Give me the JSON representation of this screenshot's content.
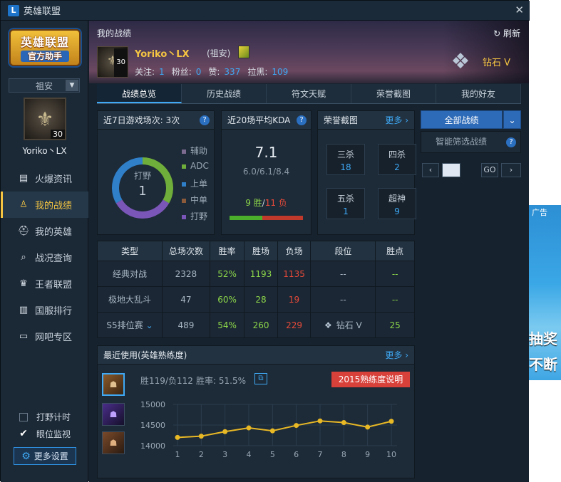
{
  "window": {
    "title": "英雄联盟"
  },
  "sidebar": {
    "logo_line1": "英雄联盟",
    "logo_line2": "官方助手",
    "server": "祖安",
    "level": "30",
    "username": "Yoriko丶LX",
    "nav": [
      {
        "label": "火爆资讯",
        "icon": "fire-icon",
        "glyph": "▤"
      },
      {
        "label": "我的战绩",
        "icon": "user-icon",
        "glyph": "♙",
        "active": true
      },
      {
        "label": "我的英雄",
        "icon": "helmet-icon",
        "glyph": "⛑"
      },
      {
        "label": "战况查询",
        "icon": "search-icon",
        "glyph": "⌕"
      },
      {
        "label": "王者联盟",
        "icon": "crown-icon",
        "glyph": "♛"
      },
      {
        "label": "国服排行",
        "icon": "chart-icon",
        "glyph": "▥"
      },
      {
        "label": "网吧专区",
        "icon": "monitor-icon",
        "glyph": "▭"
      }
    ],
    "jungle_timer": "打野计时",
    "ward_monitor": "眼位监视",
    "more_settings": "更多设置"
  },
  "header": {
    "breadcrumb": "我的战绩",
    "refresh": "刷新",
    "player_name": "Yoriko丶LX",
    "player_server": "(祖安)",
    "level": "30",
    "follow_label": "关注:",
    "follow": "1",
    "fans_label": "粉丝:",
    "fans": "0",
    "likes_label": "赞:",
    "likes": "337",
    "block_label": "拉黑:",
    "block": "109",
    "rank": "钻石 V"
  },
  "tabs": [
    "战绩总览",
    "历史战绩",
    "符文天赋",
    "荣誉截图",
    "我的好友"
  ],
  "recent7": {
    "title": "近7日游戏场次: 3次",
    "center_label": "打野",
    "center_value": "1",
    "legend": [
      {
        "label": "辅助",
        "color": "#7d6a8f"
      },
      {
        "label": "ADC",
        "color": "#6fae3a"
      },
      {
        "label": "上单",
        "color": "#2f7fc9"
      },
      {
        "label": "中单",
        "color": "#8a5a3a"
      },
      {
        "label": "打野",
        "color": "#7a56b8"
      }
    ],
    "donut": [
      {
        "value": 1,
        "color": "#6fae3a"
      },
      {
        "value": 1,
        "color": "#7a56b8"
      },
      {
        "value": 1,
        "color": "#2f7fc9"
      }
    ]
  },
  "kda": {
    "title": "近20场平均KDA",
    "value": "7.1",
    "detail": "6.0/6.1/8.4",
    "wins": "9 胜",
    "losses": "11 负",
    "sep": "/",
    "win_fraction": 0.45
  },
  "honor": {
    "title": "荣誉截图",
    "more": "更多",
    "items": [
      {
        "label": "三杀",
        "value": "18"
      },
      {
        "label": "四杀",
        "value": "2"
      },
      {
        "label": "五杀",
        "value": "1"
      },
      {
        "label": "超神",
        "value": "9"
      }
    ]
  },
  "filter": {
    "all": "全部战绩",
    "smart": "智能筛选战绩",
    "go": "GO"
  },
  "stats": {
    "headers": [
      "类型",
      "总场次数",
      "胜率",
      "胜场",
      "负场",
      "段位",
      "胜点"
    ],
    "rows": [
      [
        "经典对战",
        "2328",
        "52%",
        "1193",
        "1135",
        "--",
        "--"
      ],
      [
        "极地大乱斗",
        "47",
        "60%",
        "28",
        "19",
        "--",
        "--"
      ],
      [
        "S5排位赛",
        "489",
        "54%",
        "260",
        "229",
        "钻石 V",
        "25"
      ]
    ]
  },
  "recent_use": {
    "title": "最近使用(英雄熟练度)",
    "more": "更多",
    "wl": "胜119/负112",
    "winrate": "胜率: 51.5%",
    "btn": "2015熟练度说明"
  },
  "chart_data": {
    "type": "line",
    "x": [
      1,
      2,
      3,
      4,
      5,
      6,
      7,
      8,
      9,
      10
    ],
    "y": [
      14200,
      14230,
      14340,
      14430,
      14360,
      14490,
      14600,
      14560,
      14450,
      14590
    ],
    "yticks": [
      15000,
      14500,
      14000
    ],
    "ylim": [
      14000,
      15000
    ],
    "color": "#e8b825"
  },
  "promo": {
    "t1": "广告",
    "t2": "抽奖",
    "t3": "不断"
  }
}
